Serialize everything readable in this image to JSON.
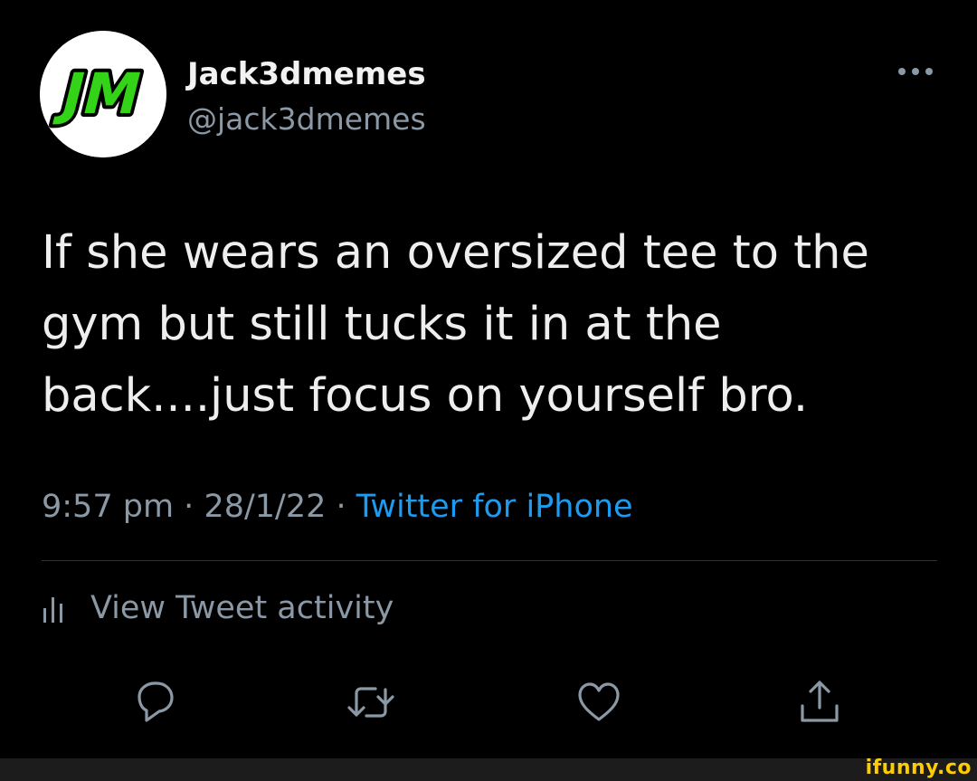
{
  "user": {
    "display_name": "Jack3dmemes",
    "handle": "@jack3dmemes",
    "avatar_text": "JM"
  },
  "tweet": {
    "lines": [
      "If she wears an oversized tee to the",
      "gym but still tucks it in at the",
      "back....just focus on yourself bro."
    ],
    "time": "9:57 pm",
    "date": "28/1/22",
    "separator": " · ",
    "source": "Twitter for iPhone"
  },
  "activity": {
    "label": "View Tweet activity"
  },
  "actions": {
    "icons": [
      "reply-icon",
      "retweet-icon",
      "like-icon",
      "share-icon"
    ]
  },
  "watermark": {
    "text": "ifunny.co"
  },
  "colors": {
    "background": "#000000",
    "text": "#e7e9ea",
    "secondary": "#8b98a5",
    "link": "#1d9bf0",
    "divider": "#2f3336",
    "avatar_logo": "#33d317",
    "watermark": "#ffcc00"
  }
}
